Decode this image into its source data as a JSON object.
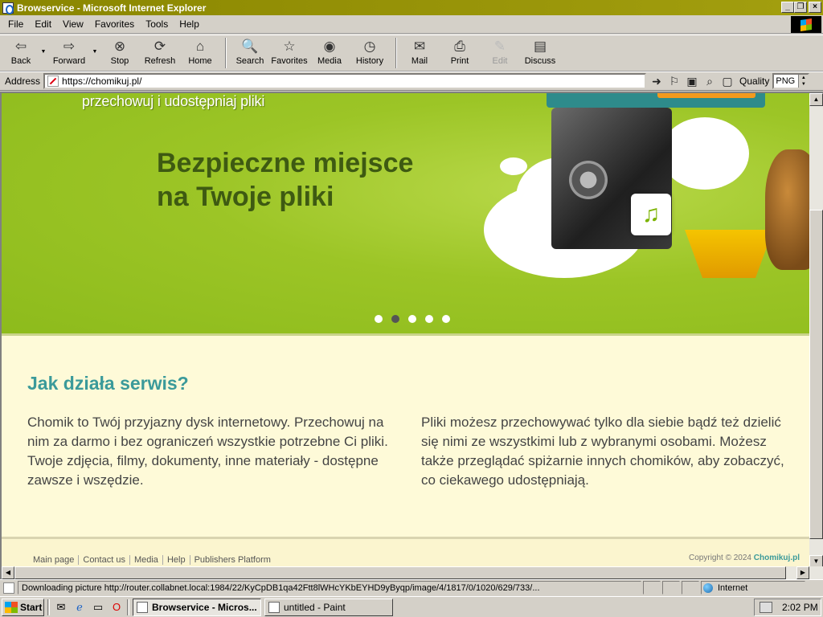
{
  "window": {
    "title": "Browservice - Microsoft Internet Explorer",
    "buttons": {
      "minimize": "_",
      "maximize": "❐",
      "close": "×"
    }
  },
  "menu": [
    "File",
    "Edit",
    "View",
    "Favorites",
    "Tools",
    "Help"
  ],
  "toolbar": {
    "back": "Back",
    "forward": "Forward",
    "stop": "Stop",
    "refresh": "Refresh",
    "home": "Home",
    "search": "Search",
    "favorites": "Favorites",
    "media": "Media",
    "history": "History",
    "mail": "Mail",
    "print": "Print",
    "edit": "Edit",
    "discuss": "Discuss"
  },
  "address": {
    "label": "Address",
    "url": "https://chomikuj.pl/",
    "quality_label": "Quality",
    "quality_value": "PNG"
  },
  "page": {
    "hero": {
      "tagline": "przechowuj i udostępniaj pliki",
      "title_line1": "Bezpieczne miejsce",
      "title_line2": "na Twoje pliki",
      "active_dot": 2,
      "dot_count": 5
    },
    "how": {
      "title": "Jak działa serwis?",
      "left": "Chomik to Twój przyjazny dysk internetowy. Przechowuj na nim za darmo i bez ograniczeń wszystkie potrzebne Ci pliki. Twoje zdjęcia, filmy, dokumenty, inne materiały - dostępne zawsze i wszędzie.",
      "right": "Pliki możesz przechowywać tylko dla siebie bądź też dzielić się nimi ze wszystkimi lub z wybranymi osobami. Możesz także przeglądać spiżarnie innych chomików, aby zobaczyć, co ciekawego udostępniają."
    },
    "footer": {
      "links": [
        "Main page",
        "Contact us",
        "Media",
        "Help",
        "Publishers Platform"
      ],
      "copyright": "Copyright © 2024",
      "brand": "Chomikuj.pl"
    }
  },
  "status": {
    "text": "Downloading picture http://router.collabnet.local:1984/22/KyCpDB1qa42Ftt8lWHcYKbEYHD9yByqp/image/4/1817/0/1020/629/733/...",
    "zone": "Internet"
  },
  "taskbar": {
    "start": "Start",
    "tasks": [
      "Browservice - Micros...",
      "untitled - Paint"
    ],
    "clock": "2:02 PM"
  },
  "colors": {
    "hero_green": "#9cc526",
    "teal": "#3b9a9a",
    "page_bg": "#fefad8",
    "title_green": "#3e5a12"
  }
}
